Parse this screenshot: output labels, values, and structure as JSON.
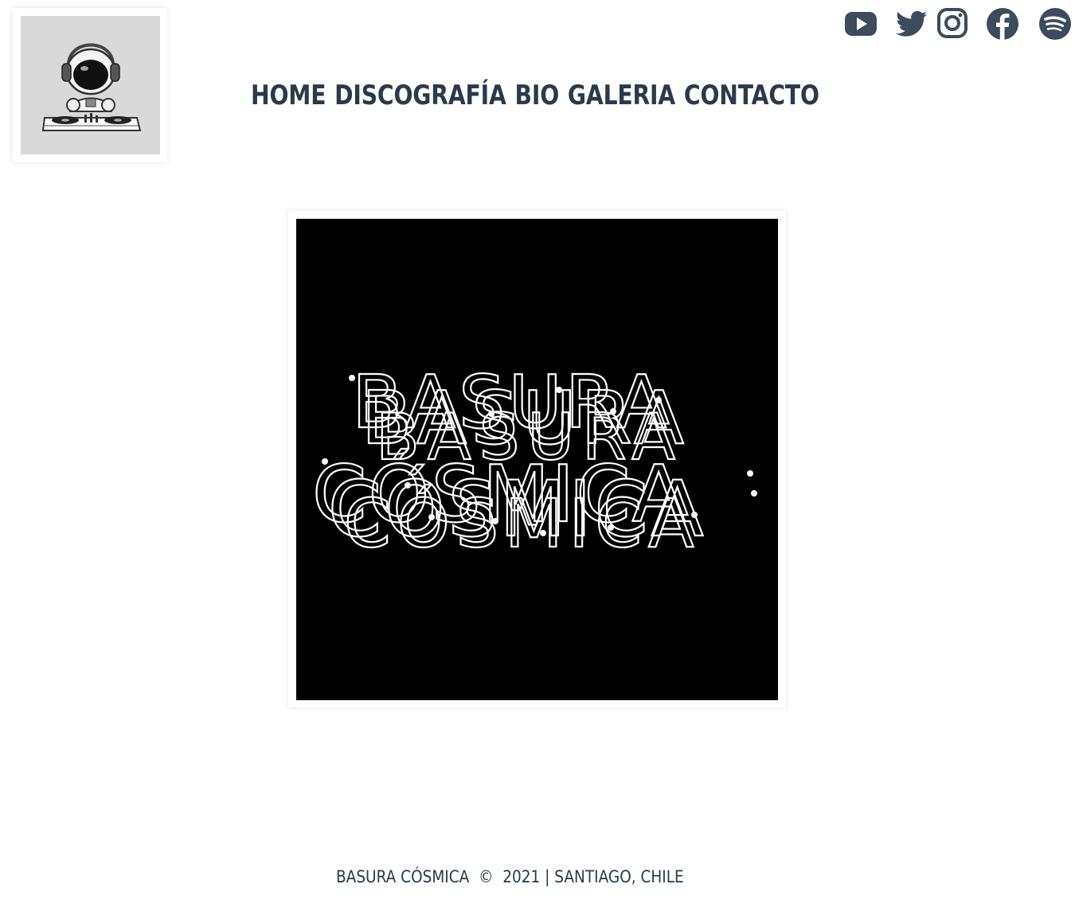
{
  "brand": {
    "logo_alt": "astronaut DJ logo"
  },
  "social": [
    {
      "name": "youtube-icon"
    },
    {
      "name": "twitter-icon"
    },
    {
      "name": "instagram-icon"
    },
    {
      "name": "facebook-icon"
    },
    {
      "name": "spotify-icon"
    }
  ],
  "nav": {
    "items": [
      "HOME",
      "DISCOGRAFÍA",
      "BIO",
      "GALERIA",
      "CONTACTO"
    ]
  },
  "album": {
    "line1": "BASURA",
    "line2": "CÓSMICA"
  },
  "footer": {
    "text": "BASURA CÓSMICA  ©  2021 | SANTIAGO, CHILE"
  },
  "colors": {
    "text": "#2b3a4a",
    "icon": "#3d4b5c",
    "album_bg": "#000000",
    "logo_bg": "#d9d9d9"
  }
}
